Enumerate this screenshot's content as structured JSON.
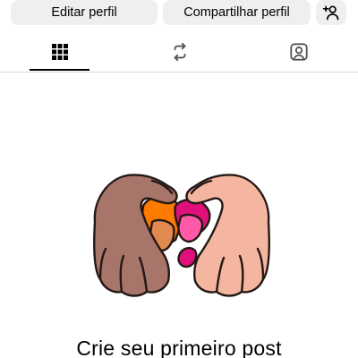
{
  "actions": {
    "edit_profile_label": "Editar perfil",
    "share_profile_label": "Compartilhar perfil",
    "add_person_icon": "add-person-icon"
  },
  "tabs": [
    {
      "icon": "grid-icon",
      "selected": true
    },
    {
      "icon": "reels-repost-icon",
      "selected": false
    },
    {
      "icon": "tagged-person-icon",
      "selected": false
    }
  ],
  "empty_state": {
    "title": "Crie seu primeiro post",
    "illustration": "heart-hands-illustration"
  },
  "colors": {
    "button_bg": "#efefef",
    "divider": "#dbdbdb",
    "text": "#000000"
  }
}
